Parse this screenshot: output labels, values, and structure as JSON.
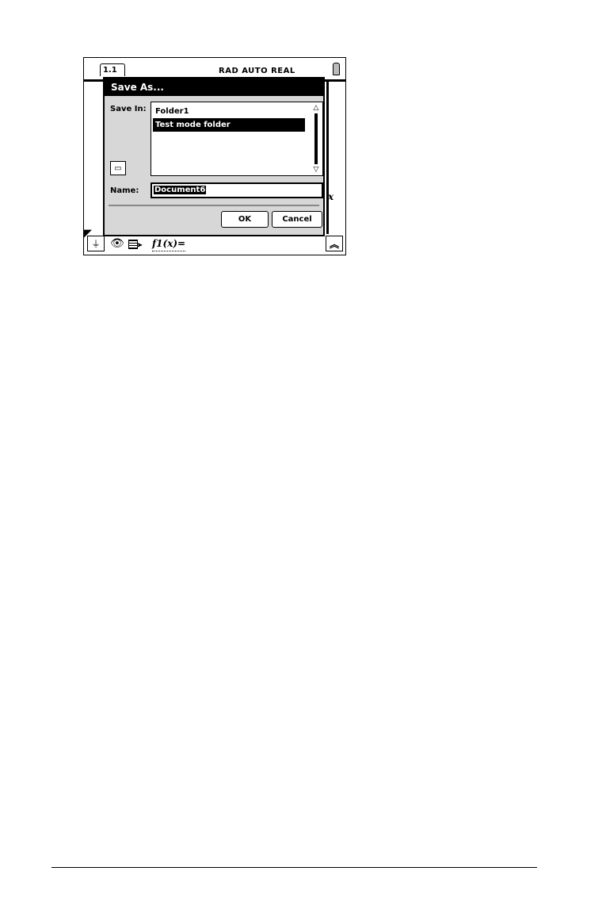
{
  "status": {
    "page_tab": "1.1",
    "mode": "RAD  AUTO  REAL"
  },
  "graph": {
    "axis_label": "x",
    "function_entry": "f1(x)="
  },
  "dialog": {
    "title": "Save As...",
    "save_in_label": "Save In:",
    "folders": [
      "Folder1",
      "Test mode folder"
    ],
    "selected_folder_index": 1,
    "name_label": "Name:",
    "name_value": "Document6",
    "ok_label": "OK",
    "cancel_label": "Cancel"
  },
  "icons": {
    "new_folder": "new-folder-icon",
    "scroll_up": "scroll-up-arrow-icon",
    "scroll_down": "scroll-down-arrow-icon",
    "battery": "battery-icon",
    "graph_tool": "graph-tool-icon",
    "view": "eye-icon",
    "select": "grid-pointer-icon",
    "expand": "double-chevron-up-icon"
  }
}
